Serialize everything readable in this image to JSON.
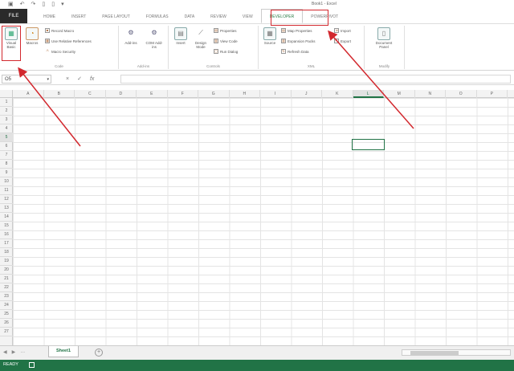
{
  "titlebar": {
    "qat_icons": [
      "save-icon",
      "undo-icon",
      "redo-icon",
      "new-icon",
      "open-icon",
      "customize-icon"
    ],
    "qat_glyphs": [
      "▣",
      "↶",
      "↷",
      "▯",
      "▯",
      "▾"
    ],
    "app_title": "Book1 - Excel"
  },
  "tabs": {
    "file": "FILE",
    "items": [
      {
        "label": "HOME"
      },
      {
        "label": "INSERT"
      },
      {
        "label": "PAGE LAYOUT"
      },
      {
        "label": "FORMULAS"
      },
      {
        "label": "DATA"
      },
      {
        "label": "REVIEW"
      },
      {
        "label": "VIEW"
      },
      {
        "label": "DEVELOPER",
        "active": true
      },
      {
        "label": "POWERPIVOT"
      }
    ]
  },
  "ribbon": {
    "code": {
      "label": "Code",
      "visual_basic": "Visual Basic",
      "macros": "Macros",
      "record_macro": "Record Macro",
      "use_relative": "Use Relative References",
      "macro_security": "Macro Security"
    },
    "addins": {
      "label": "Add-ins",
      "addins": "Add-ins",
      "com_addins": "COM Add-ins"
    },
    "controls": {
      "label": "Controls",
      "insert": "Insert",
      "design_mode": "Design Mode",
      "properties": "Properties",
      "view_code": "View Code",
      "run_dialog": "Run Dialog"
    },
    "xml": {
      "label": "XML",
      "source": "Source",
      "map_properties": "Map Properties",
      "expansion_packs": "Expansion Packs",
      "refresh_data": "Refresh Data",
      "import": "Import",
      "export": "Export"
    },
    "modify": {
      "label": "Modify",
      "document_panel": "Document Panel"
    }
  },
  "formula_bar": {
    "namebox": "O5",
    "cancel": "×",
    "enter": "✓",
    "fx": "fx",
    "value": ""
  },
  "grid": {
    "columns": [
      "A",
      "B",
      "C",
      "D",
      "E",
      "F",
      "G",
      "H",
      "I",
      "J",
      "K",
      "L",
      "M",
      "N",
      "O",
      "P"
    ],
    "rows": [
      "1",
      "2",
      "3",
      "4",
      "5",
      "6",
      "7",
      "8",
      "9",
      "10",
      "11",
      "12",
      "13",
      "14",
      "15",
      "16",
      "17",
      "18",
      "19",
      "20",
      "21",
      "22",
      "23",
      "24",
      "25",
      "26",
      "27"
    ],
    "selected_column": "L",
    "selected_row": "5"
  },
  "sheets": {
    "nav": [
      "◀",
      "▶",
      "…"
    ],
    "tabs": [
      "Sheet1"
    ],
    "add": "+"
  },
  "status": {
    "text": "READY"
  },
  "colors": {
    "excel_green": "#217346",
    "annotation_red": "#d2282e"
  }
}
